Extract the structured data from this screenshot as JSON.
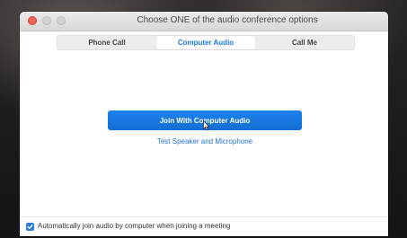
{
  "window": {
    "title": "Choose ONE of the audio conference options"
  },
  "tabs": [
    {
      "label": "Phone Call",
      "active": false
    },
    {
      "label": "Computer Audio",
      "active": true
    },
    {
      "label": "Call Me",
      "active": false
    }
  ],
  "main": {
    "join_button_label": "Join With Computer Audio",
    "test_link_label": "Test Speaker and Microphone"
  },
  "footer": {
    "auto_join_checked": true,
    "auto_join_label": "Automatically join audio by computer when joining a meeting"
  },
  "colors": {
    "accent": "#1f7ae0",
    "close_button": "#f2625a"
  }
}
